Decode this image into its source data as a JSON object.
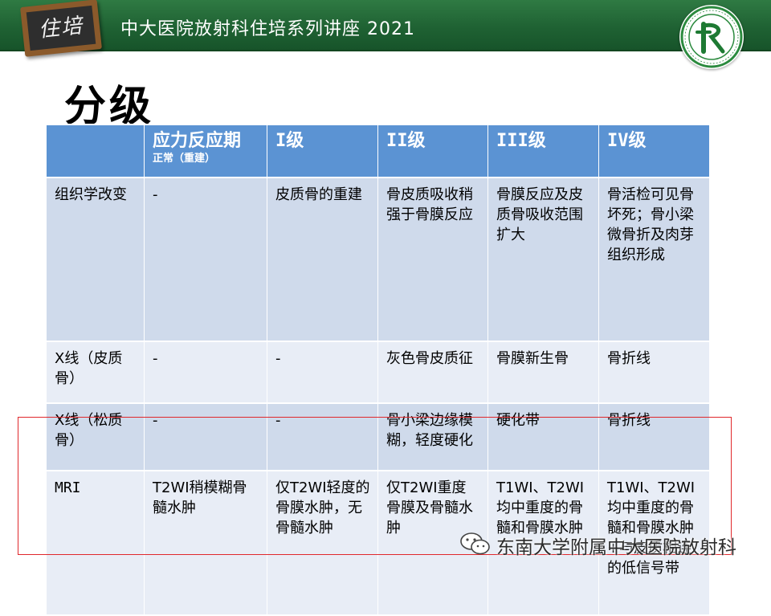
{
  "banner": {
    "chalk_text": "住培",
    "title": "中大医院放射科住培系列讲座 2021"
  },
  "page": {
    "heading": "分级"
  },
  "table": {
    "headers": [
      {
        "label": "",
        "sub": ""
      },
      {
        "label": "应力反应期",
        "sub": "正常（重建）"
      },
      {
        "label": "I级",
        "sub": ""
      },
      {
        "label": "II级",
        "sub": ""
      },
      {
        "label": "III级",
        "sub": ""
      },
      {
        "label": "IV级",
        "sub": ""
      }
    ],
    "rows": [
      {
        "cells": [
          "组织学改变",
          "-",
          "皮质骨的重建",
          "骨皮质吸收稍强于骨膜反应",
          "骨膜反应及皮质骨吸收范围扩大",
          "骨活检可见骨坏死；骨小梁微骨折及肉芽组织形成"
        ]
      },
      {
        "cells": [
          "X线（皮质骨）",
          "-",
          "-",
          "灰色骨皮质征",
          "骨膜新生骨",
          "骨折线"
        ]
      },
      {
        "cells": [
          "X线（松质骨）",
          "-",
          "-",
          "骨小梁边缘模糊，轻度硬化",
          "硬化带",
          "骨折线"
        ]
      },
      {
        "cells": [
          "MRI",
          "T2WI稍模糊骨髓水肿",
          "仅T2WI轻度的骨膜水肿，无骨髓水肿",
          "仅T2WI重度骨膜及骨髓水肿",
          "T1WI、T2WI均中重度的骨髓和骨膜水肿",
          "T1WI、T2WI均中重度的骨髓和骨膜水肿+与皮质相连的低信号带"
        ]
      }
    ]
  },
  "watermark": {
    "icon": "wechat-icon",
    "text": "东南大学附属中大医院放射科"
  },
  "colors": {
    "banner": "#1f6233",
    "header_fill": "#5b93d3",
    "row_dark": "#cfdaeb",
    "row_light": "#e8edf6",
    "highlight": "#e0282c"
  }
}
